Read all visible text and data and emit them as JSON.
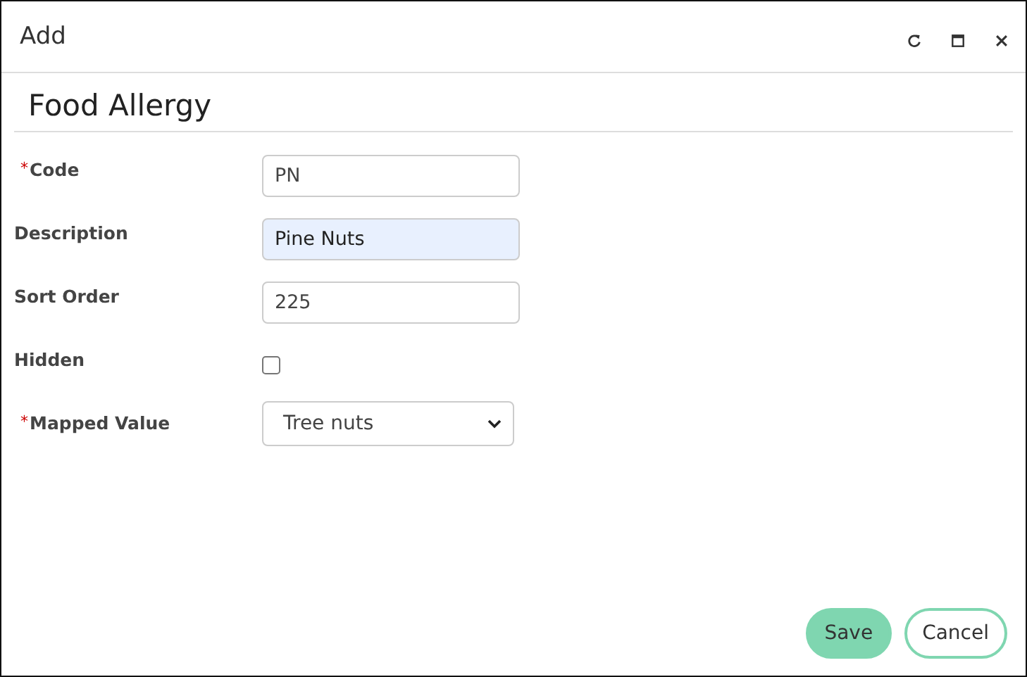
{
  "window": {
    "title": "Add",
    "buttons": [
      {
        "kind": "refresh"
      },
      {
        "kind": "maximize"
      },
      {
        "kind": "close"
      }
    ]
  },
  "form": {
    "title": "Food Allergy",
    "fields": [
      {
        "kind": "text",
        "required_mark": "*",
        "label": "Code",
        "value": "PN",
        "highlighted": false
      },
      {
        "kind": "text",
        "label": "Description",
        "value": "Pine Nuts",
        "highlighted": true
      },
      {
        "kind": "text",
        "label": "Sort Order",
        "value": "225",
        "highlighted": false
      },
      {
        "kind": "checkbox",
        "label": "Hidden",
        "checked": false
      },
      {
        "kind": "select",
        "required_mark": "*",
        "label": "Mapped Value",
        "value": "Tree nuts"
      }
    ]
  },
  "buttons": [
    {
      "label": "Save",
      "kind": "primary"
    },
    {
      "label": "Cancel",
      "kind": "secondary"
    }
  ]
}
